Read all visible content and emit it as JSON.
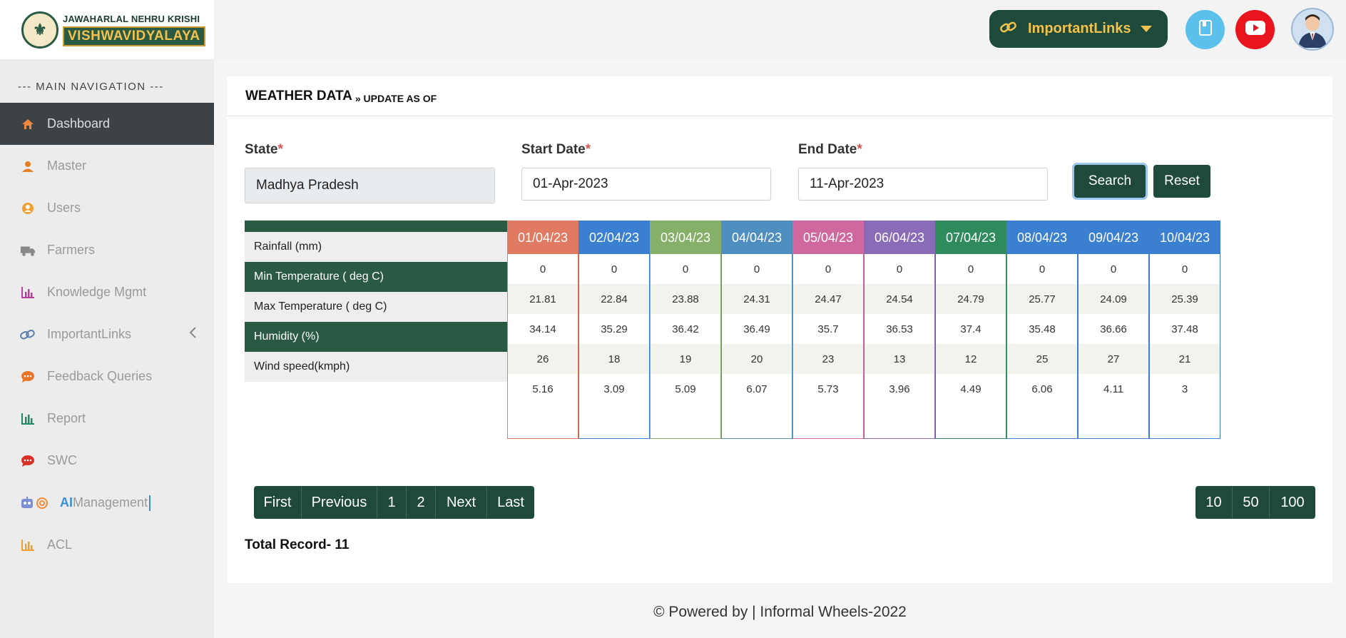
{
  "brand": {
    "line1": "JAWAHARLAL NEHRU KRISHI",
    "line2": "VISHWAVIDYALAYA",
    "emblem_glyph": "⚜"
  },
  "sidebar": {
    "title": "--- MAIN NAVIGATION ---",
    "items": [
      {
        "label": "Dashboard",
        "icon": "home-icon",
        "color": "#f0883e"
      },
      {
        "label": "Master",
        "icon": "user-icon",
        "color": "#e67e22"
      },
      {
        "label": "Users",
        "icon": "user-circle-icon",
        "color": "#f0a030"
      },
      {
        "label": "Farmers",
        "icon": "truck-icon",
        "color": "#888888"
      },
      {
        "label": "Knowledge Mgmt",
        "icon": "bar-chart-icon",
        "color": "#b83fa0"
      },
      {
        "label": "ImportantLinks",
        "icon": "link-icon",
        "color": "#5a7fb0"
      },
      {
        "label": "Feedback Queries",
        "icon": "chat-icon",
        "color": "#e8752a"
      },
      {
        "label": "Report",
        "icon": "report-icon",
        "color": "#1f8a6a"
      },
      {
        "label": "SWC",
        "icon": "speech-icon",
        "color": "#d93025"
      },
      {
        "label_ai": "AI",
        "label": "Management",
        "icon": "robot-icon",
        "color": "#5a7fb0"
      },
      {
        "label": "ACL",
        "icon": "acl-chart-icon",
        "color": "#f0a030"
      }
    ]
  },
  "topbar": {
    "important_links": "ImportantLinks",
    "colors": {
      "book": "#5bc0eb",
      "youtube": "#e8141e"
    }
  },
  "card": {
    "title": "WEATHER DATA",
    "subtitle": "» UPDATE AS OF"
  },
  "form": {
    "state_label": "State",
    "state_value": "Madhya Pradesh",
    "start_label": "Start Date",
    "start_value": "01-Apr-2023",
    "end_label": "End Date",
    "end_value": "11-Apr-2023",
    "required": "*",
    "search": "Search",
    "reset": "Reset"
  },
  "table": {
    "rows": [
      "Rainfall (mm)",
      "Min Temperature ( deg C)",
      "Max Temperature ( deg C)",
      "Humidity (%)",
      "Wind speed(kmph)"
    ],
    "columns": [
      {
        "date": "01/04/23",
        "color": "#e07a62",
        "values": [
          "0",
          "21.81",
          "34.14",
          "26",
          "5.16"
        ]
      },
      {
        "date": "02/04/23",
        "color": "#3b7fd0",
        "values": [
          "0",
          "22.84",
          "35.29",
          "18",
          "3.09"
        ]
      },
      {
        "date": "03/04/23",
        "color": "#86b06a",
        "values": [
          "0",
          "23.88",
          "36.42",
          "19",
          "5.09"
        ]
      },
      {
        "date": "04/04/23",
        "color": "#4f8fc0",
        "values": [
          "0",
          "24.31",
          "36.49",
          "20",
          "6.07"
        ]
      },
      {
        "date": "05/04/23",
        "color": "#d068a0",
        "values": [
          "0",
          "24.47",
          "35.7",
          "23",
          "5.73"
        ]
      },
      {
        "date": "06/04/23",
        "color": "#8a6bb8",
        "values": [
          "0",
          "24.54",
          "36.53",
          "13",
          "3.96"
        ]
      },
      {
        "date": "07/04/23",
        "color": "#2f8a5e",
        "values": [
          "0",
          "24.79",
          "37.4",
          "12",
          "4.49"
        ]
      },
      {
        "date": "08/04/23",
        "color": "#3b7fd0",
        "values": [
          "0",
          "25.77",
          "35.48",
          "25",
          "6.06"
        ]
      },
      {
        "date": "09/04/23",
        "color": "#3b7fd0",
        "values": [
          "0",
          "24.09",
          "36.66",
          "27",
          "4.11"
        ]
      },
      {
        "date": "10/04/23",
        "color": "#3b7fd0",
        "values": [
          "0",
          "25.39",
          "37.48",
          "21",
          "3"
        ]
      }
    ]
  },
  "pager": {
    "first": "First",
    "previous": "Previous",
    "p1": "1",
    "p2": "2",
    "next": "Next",
    "last": "Last"
  },
  "sizes": {
    "s10": "10",
    "s50": "50",
    "s100": "100"
  },
  "total": "Total Record- 11",
  "footer": "© Powered by | Informal Wheels-2022"
}
